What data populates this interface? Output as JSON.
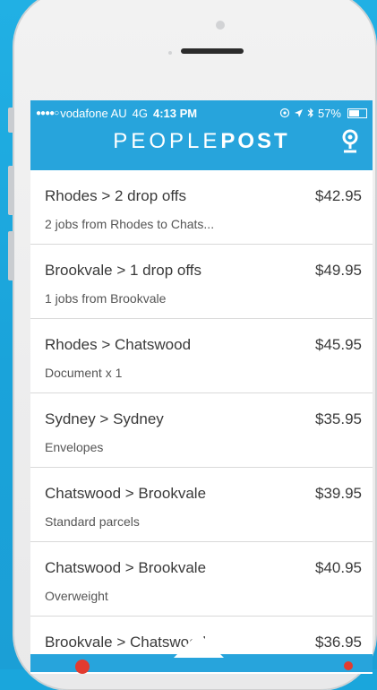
{
  "status_bar": {
    "signal": "●●●●○",
    "carrier": "vodafone AU",
    "network": "4G",
    "time": "4:13 PM",
    "battery": "57%"
  },
  "app": {
    "title_left": "PEOPLE",
    "title_right": "POST"
  },
  "jobs": [
    {
      "route": "Rhodes > 2 drop offs",
      "price": "$42.95",
      "detail": "2 jobs from Rhodes to Chats..."
    },
    {
      "route": "Brookvale > 1 drop offs",
      "price": "$49.95",
      "detail": "1 jobs from Brookvale"
    },
    {
      "route": "Rhodes > Chatswood",
      "price": "$45.95",
      "detail": "Document x 1"
    },
    {
      "route": "Sydney > Sydney",
      "price": "$35.95",
      "detail": "Envelopes"
    },
    {
      "route": "Chatswood > Brookvale",
      "price": "$39.95",
      "detail": "Standard parcels"
    },
    {
      "route": "Chatswood > Brookvale",
      "price": "$40.95",
      "detail": "Overweight"
    },
    {
      "route": "Brookvale > Chatswood",
      "price": "$36.95",
      "detail": ""
    }
  ],
  "colors": {
    "brand_blue": "#27a4dc",
    "background": "#1aa6dc"
  }
}
